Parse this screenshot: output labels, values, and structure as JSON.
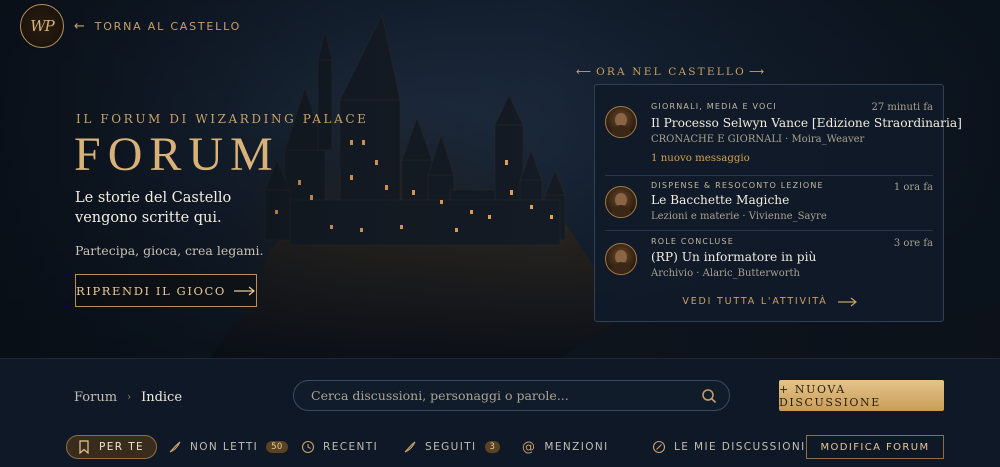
{
  "brand": {
    "logo_text": "WP",
    "back_label": "TORNA AL CASTELLO"
  },
  "hero": {
    "subtitle": "IL FORUM DI WIZARDING PALACE",
    "title": "FORUM",
    "tagline": "Le storie del Castello vengono scritte qui.",
    "subtext": "Partecipa, gioca, crea legami.",
    "resume_button": "RIPRENDI IL GIOCO"
  },
  "activity": {
    "header": "ORA NEL CASTELLO",
    "items": [
      {
        "category": "GIORNALI, MEDIA E VOCI",
        "time": "27 minuti fa",
        "title": "Il Processo Selwyn Vance [Edizione Straordinaria]",
        "meta": "CRONACHE E GIORNALI · Moira_Weaver",
        "new_messages": "1 nuovo messaggio"
      },
      {
        "category": "DISPENSE & RESOCONTO LEZIONE",
        "time": "1 ora fa",
        "title": "Le Bacchette Magiche",
        "meta": "Lezioni e materie · Vivienne_Sayre"
      },
      {
        "category": "ROLE CONCLUSE",
        "time": "3 ore fa",
        "title": "(RP) Un informatore in più",
        "meta": "Archivio · Alaric_Butterworth"
      }
    ],
    "see_all": "VEDI TUTTA L'ATTIVITÀ"
  },
  "toolbar": {
    "breadcrumb": [
      "Forum",
      "Indice"
    ],
    "search_placeholder": "Cerca discussioni, personaggi o parole...",
    "new_discussion": "+ NUOVA DISCUSSIONE",
    "tabs": [
      {
        "label": "PER TE",
        "icon": "bookmark-icon"
      },
      {
        "label": "NON LETTI",
        "icon": "feather-icon",
        "badge": "50"
      },
      {
        "label": "RECENTI",
        "icon": "clock-icon"
      },
      {
        "label": "SEGUITI",
        "icon": "feather-icon",
        "badge": "3"
      },
      {
        "label": "MENZIONI",
        "icon": "at-icon"
      },
      {
        "label": "LE MIE DISCUSSIONI",
        "icon": "quill-circle-icon"
      }
    ],
    "edit_forum": "MODIFICA FORUM"
  },
  "colors": {
    "background": "#0d1520",
    "gold_accent": "#c9a068",
    "button_gold": "#d9b27a",
    "panel_bg": "#101a28"
  }
}
